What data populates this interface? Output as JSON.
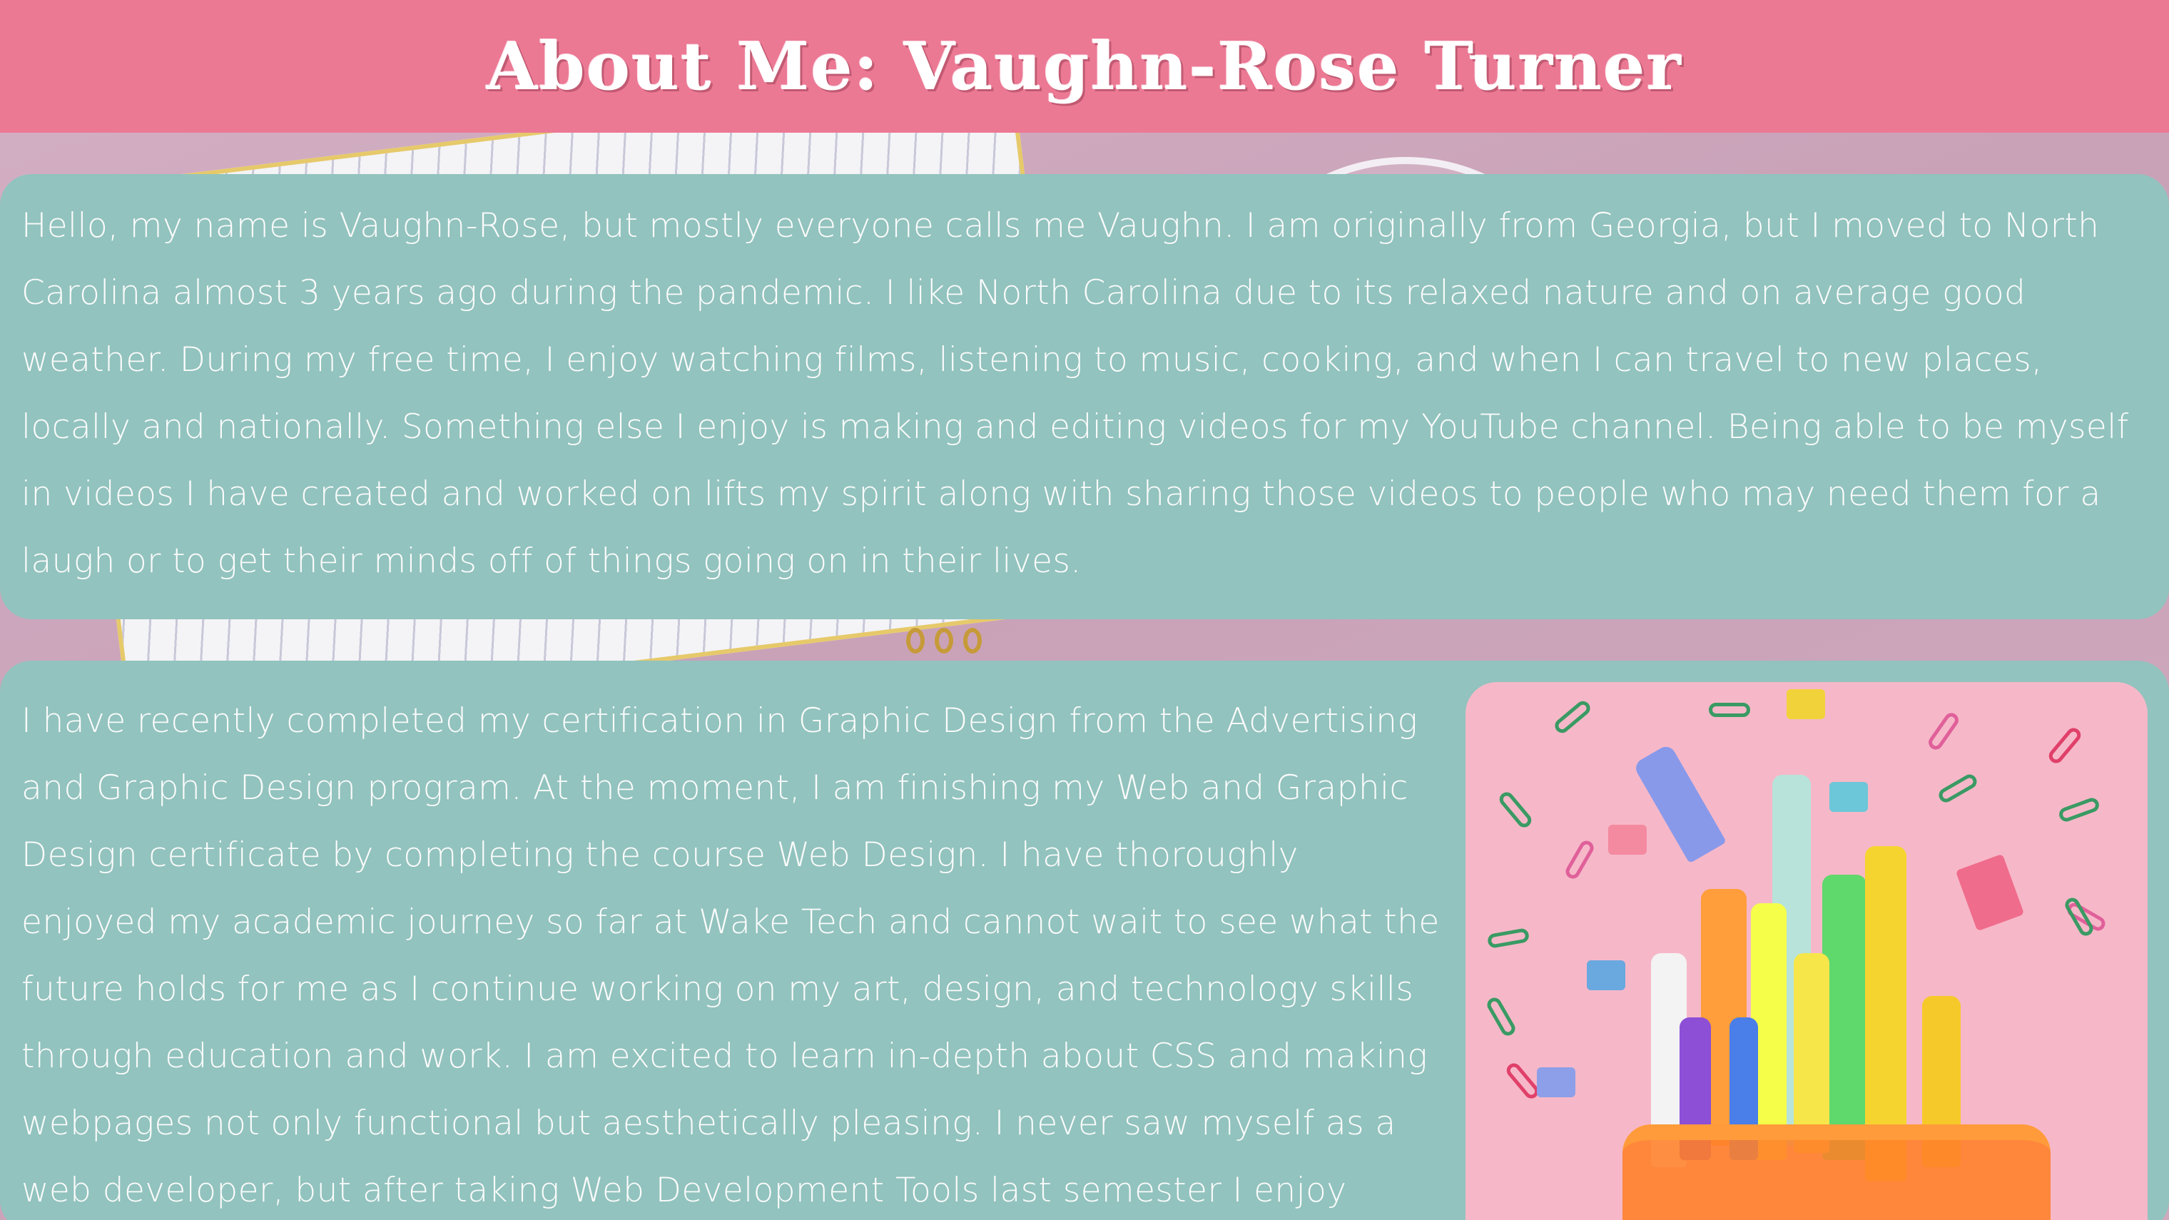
{
  "header": {
    "title": "About Me: Vaughn-Rose Turner"
  },
  "sections": {
    "intro": {
      "text": "Hello, my name is Vaughn-Rose, but mostly everyone calls me Vaughn. I am originally from Georgia, but I moved to North Carolina almost 3 years ago during the pandemic. I like North Carolina due to its relaxed nature and on average good weather. During my free time, I enjoy watching films, listening to music, cooking, and when I can travel to new places, locally and nationally. Something else I enjoy is making and editing videos for my YouTube channel. Being able to be myself in videos I have created and worked on lifts my spirit along with sharing those videos to people who may need them for a laugh or to get their minds off of things going on in their lives."
    },
    "education": {
      "text": "I have recently completed my certification in Graphic Design from the Advertising and Graphic Design program. At the moment, I am finishing my Web and Graphic Design certificate by completing the course Web Design. I have thoroughly enjoyed my academic journey so far at Wake Tech and cannot wait to see what the future holds for me as I continue working on my art, design, and technology skills through education and work. I am excited to learn in-depth about CSS and making webpages not only functional but aesthetically pleasing. I never saw myself as a web developer, but after taking Web Development Tools last semester I enjoy"
    }
  },
  "colors": {
    "header_bg": "#ec7994",
    "card_bg": "#92c3be",
    "text": "#fbfbfb"
  }
}
